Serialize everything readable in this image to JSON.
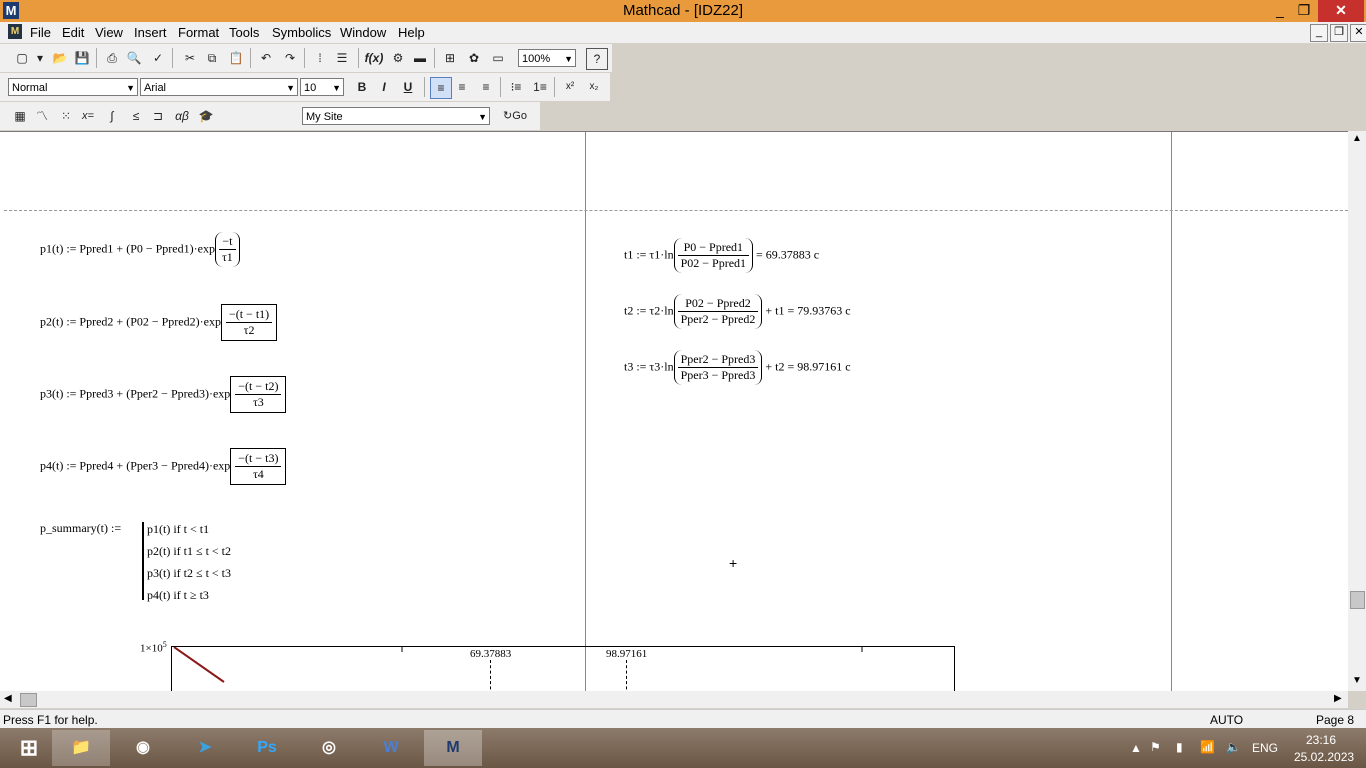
{
  "window": {
    "title": "Mathcad - [IDZ22]",
    "logo": "M",
    "minimize": "_",
    "restore": "❐",
    "close": "✕"
  },
  "menu": [
    "File",
    "Edit",
    "View",
    "Insert",
    "Format",
    "Tools",
    "Symbolics",
    "Window",
    "Help"
  ],
  "format_toolbar": {
    "style": "Normal",
    "font": "Arial",
    "size": "10",
    "zoom": "100%"
  },
  "resource_toolbar": {
    "site": "My Site",
    "go": "Go"
  },
  "icons": {
    "std": [
      "new-icon",
      "open-icon",
      "save-icon",
      "print-icon",
      "print-preview-icon",
      "spell-check-icon",
      "cut-icon",
      "copy-icon",
      "paste-icon",
      "undo-icon",
      "redo-icon",
      "align-across-icon",
      "align-down-icon",
      "insert-function-icon",
      "insert-unit-icon",
      "calculate-icon",
      "insert-component-icon",
      "resource-icon",
      "insert-math-region-icon",
      "help-icon"
    ],
    "math": [
      "calculator-toolbar-icon",
      "graph-toolbar-icon",
      "matrix-toolbar-icon",
      "evaluation-toolbar-icon",
      "calculus-toolbar-icon",
      "boolean-toolbar-icon",
      "programming-toolbar-icon",
      "greek-toolbar-icon",
      "symbolic-toolbar-icon"
    ]
  },
  "equations": {
    "p1": {
      "lhs": "p1(t) := Ppred1 + (P0 − Ppred1)·exp",
      "num": "−t",
      "den": "τ1"
    },
    "p2": {
      "lhs": "p2(t) := Ppred2 + (P02 − Ppred2)·exp",
      "num": "−(t − t1)",
      "den": "τ2"
    },
    "p3": {
      "lhs": "p3(t) := Ppred3 + (Pper2 − Ppred3)·exp",
      "num": "−(t − t2)",
      "den": "τ3"
    },
    "p4": {
      "lhs": "p4(t) := Ppred4 + (Pper3 − Ppred4)·exp",
      "num": "−(t − t3)",
      "den": "τ4"
    },
    "t1": {
      "lhs": "t1 := τ1·ln",
      "num": "P0 − Ppred1",
      "den": "P02 − Ppred1",
      "rhs": "= 69.37883 c"
    },
    "t2": {
      "lhs": "t2 := τ2·ln",
      "num": "P02 − Ppred2",
      "den": "Pper2 − Ppred2",
      "rhs": "+ t1 = 79.93763 c"
    },
    "t3": {
      "lhs": "t3 := τ3·ln",
      "num": "Pper2 − Ppred3",
      "den": "Pper3 − Ppred3",
      "rhs": "+ t2 = 98.97161 c"
    },
    "summary": {
      "lhs": "p_summary(t) :=",
      "lines": [
        "p1(t)  if  t < t1",
        "p2(t)  if  t1 ≤ t < t2",
        "p3(t)  if  t2 ≤ t < t3",
        "p4(t)  if  t ≥ t3"
      ]
    }
  },
  "plot": {
    "ymax_label": "1×10",
    "ymax_exp": "5",
    "marker1": "69.37883",
    "marker2": "98.97161",
    "line_color": "#8b1a1a"
  },
  "cursor": "+",
  "status": {
    "help": "Press F1 for help.",
    "mode": "AUTO",
    "page": "Page 8"
  },
  "taskbar": {
    "apps": [
      "start-icon",
      "file-explorer-icon",
      "app-owl-icon",
      "telegram-icon",
      "photoshop-icon",
      "chrome-icon",
      "word-icon",
      "mathcad-icon"
    ],
    "app_labels": [
      "",
      "",
      "",
      "",
      "Ps",
      "",
      "W",
      "M"
    ],
    "lang": "ENG",
    "time": "23:16",
    "date": "25.02.2023"
  }
}
